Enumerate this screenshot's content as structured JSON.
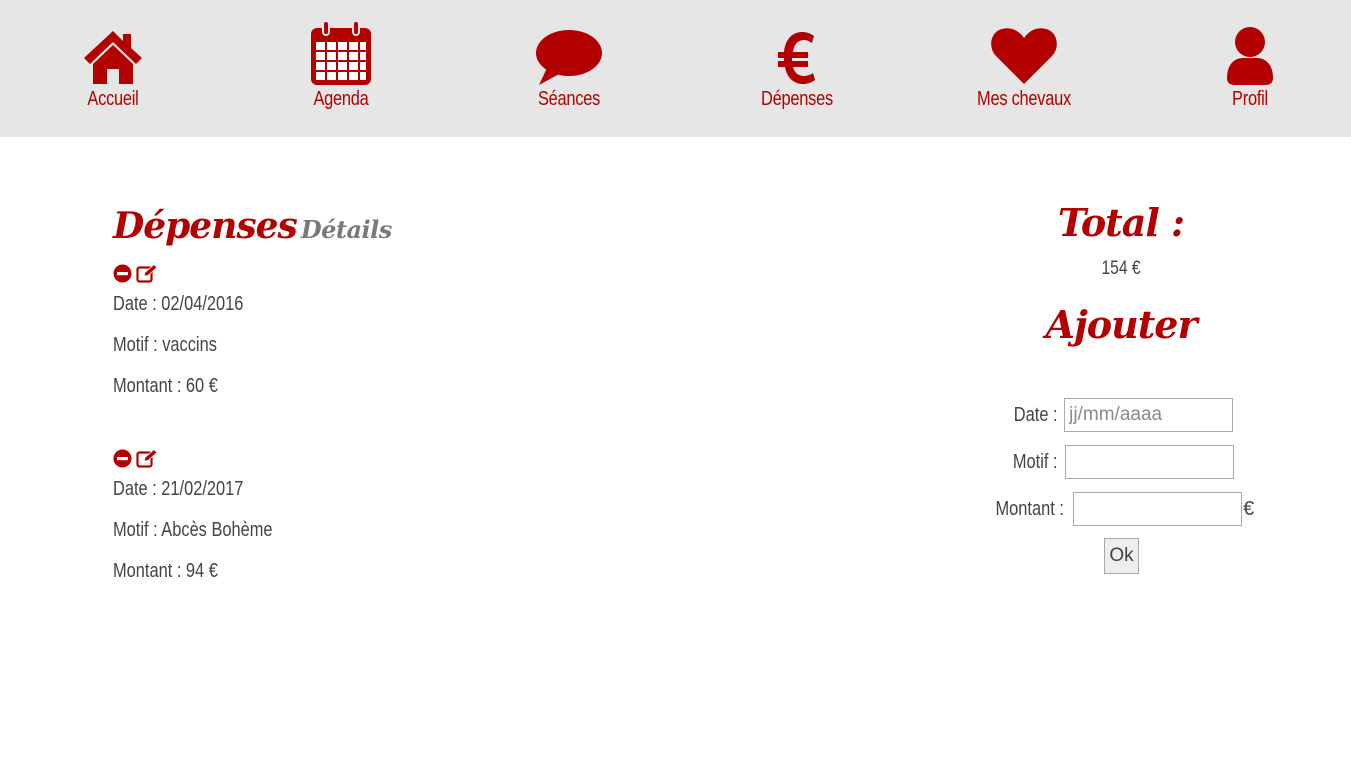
{
  "nav": {
    "items": [
      {
        "label": "Accueil",
        "icon": "home-icon"
      },
      {
        "label": "Agenda",
        "icon": "calendar-icon"
      },
      {
        "label": "Séances",
        "icon": "speech-bubble-icon"
      },
      {
        "label": "Dépenses",
        "icon": "euro-icon"
      },
      {
        "label": "Mes chevaux",
        "icon": "heart-icon"
      },
      {
        "label": "Profil",
        "icon": "user-icon"
      }
    ]
  },
  "main": {
    "title": "Dépenses",
    "subtitle": "Détails",
    "expenses": [
      {
        "date": "Date : 02/04/2016",
        "motif": "Motif : vaccins",
        "montant": "Montant : 60 €"
      },
      {
        "date": "Date : 21/02/2017",
        "motif": "Motif : Abcès Bohème",
        "montant": "Montant : 94 €"
      }
    ]
  },
  "sidebar": {
    "total_title": "Total :",
    "total_value": "154 €",
    "add_title": "Ajouter",
    "form": {
      "date_label": "Date :",
      "date_placeholder": "jj/mm/aaaa",
      "motif_label": "Motif :",
      "montant_label": "Montant :",
      "currency": "€",
      "submit_label": "Ok"
    }
  },
  "colors": {
    "accent": "#b30000",
    "nav_background": "#e6e6e6",
    "text": "#444444",
    "subtitle": "#7a7a7a"
  }
}
